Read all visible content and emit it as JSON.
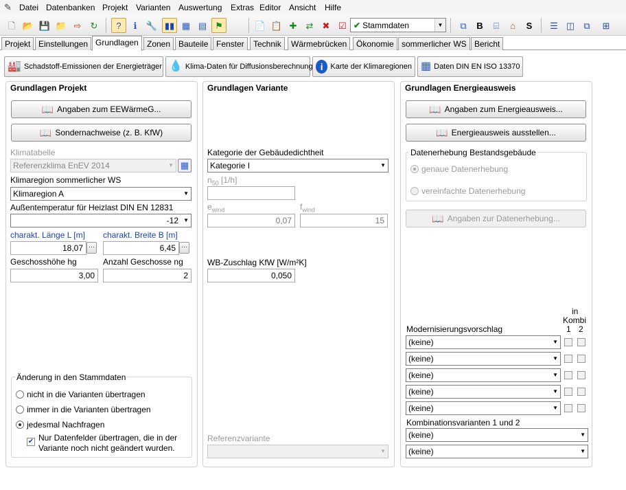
{
  "menu": [
    "Datei",
    "Datenbanken",
    "Projekt",
    "Varianten",
    "Auswertung",
    "Extras",
    "Editor",
    "Ansicht",
    "Hilfe"
  ],
  "toolbar": {
    "stammdaten": "Stammdaten"
  },
  "tabs": [
    "Projekt",
    "Einstellungen",
    "Grundlagen",
    "Zonen",
    "Bauteile",
    "Fenster",
    "Technik",
    "Wärmebrücken",
    "Ökonomie",
    "sommerlicher WS",
    "Bericht"
  ],
  "subtoolbar": {
    "schadstoff": "Schadstoff-Emissionen der Energieträger",
    "klima": "Klima-Daten für Diffusionsberechnung",
    "karte": "Karte der Klimaregionen",
    "daten": "Daten DIN EN ISO 13370"
  },
  "projekt": {
    "title": "Grundlagen Projekt",
    "btn_eewaerme": "Angaben zum EEWärmeG...",
    "btn_sonder": "Sondernachweise (z. B. KfW)",
    "klimatabelle_label": "Klimatabelle",
    "klimatabelle_value": "Referenzklima EnEV 2014",
    "klimaregion_label": "Klimaregion sommerlicher WS",
    "klimaregion_value": "Klimaregion A",
    "aussentemp_label": "Außentemperatur für Heizlast DIN EN 12831",
    "aussentemp_value": "-12",
    "laenge_label": "charakt. Länge L [m]",
    "laenge_value": "18,07",
    "breite_label": "charakt. Breite B [m]",
    "breite_value": "6,45",
    "geschosshoehe_label": "Geschosshöhe hg",
    "geschosshoehe_value": "3,00",
    "anzahl_label": "Anzahl Geschosse ng",
    "anzahl_value": "2",
    "aenderung_title": "Änderung in den Stammdaten",
    "radio_nicht": "nicht in die Varianten übertragen",
    "radio_immer": "immer in die Varianten übertragen",
    "radio_jedesmal": "jedesmal Nachfragen",
    "checkbox_text1": "Nur Datenfelder übertragen, die in der",
    "checkbox_text2": "Variante noch nicht geändert wurden."
  },
  "variante": {
    "title": "Grundlagen Variante",
    "kategorie_label": "Kategorie der Gebäudedichtheit",
    "kategorie_value": "Kategorie I",
    "n50_label": "n",
    "n50_sub": "50",
    "n50_unit": "[1/h]",
    "ewind_label": "e",
    "ewind_sub": "wind",
    "ewind_value": "0,07",
    "fwind_label": "f",
    "fwind_sub": "wind",
    "fwind_value": "15",
    "wb_label": "WB-Zuschlag KfW [W/m²K]",
    "wb_value": "0,050",
    "referenz_label": "Referenzvariante"
  },
  "energie": {
    "title": "Grundlagen Energieausweis",
    "btn_angaben": "Angaben zum Energieausweis...",
    "btn_ausstellen": "Energieausweis ausstellen...",
    "bestand_title": "Datenerhebung Bestandsgebäude",
    "radio_genau": "genaue Datenerhebung",
    "radio_vereinfacht": "vereinfachte Datenerhebung",
    "btn_datenerhebung": "Angaben zur Datenerhebung...",
    "modern_label": "Modernisierungsvorschlag",
    "in_label": "in",
    "kombi_label": "Kombi",
    "col1": "1",
    "col2": "2",
    "modern_values": [
      "(keine)",
      "(keine)",
      "(keine)",
      "(keine)",
      "(keine)"
    ],
    "kombi_title": "Kombinationsvarianten 1 und 2",
    "kombi_values": [
      "(keine)",
      "(keine)"
    ]
  }
}
